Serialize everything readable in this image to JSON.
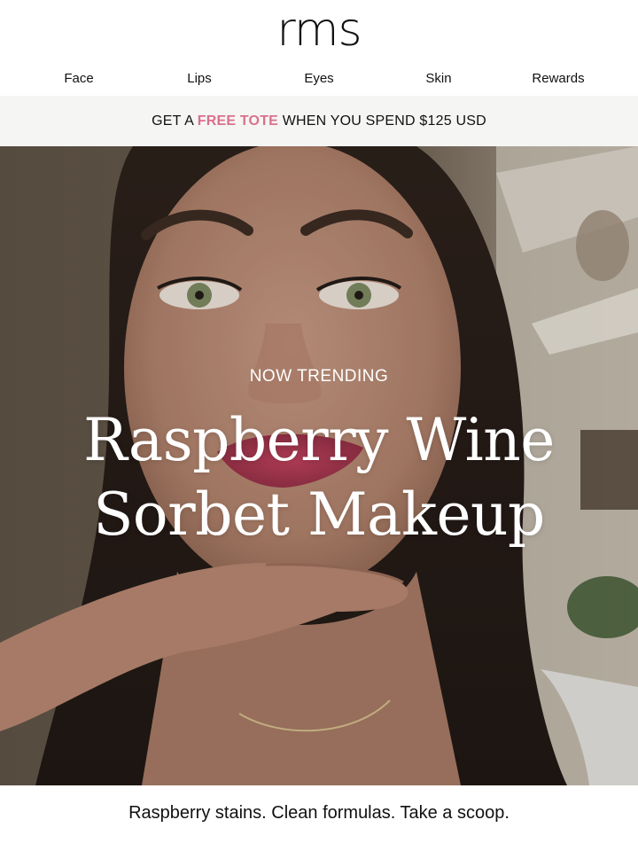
{
  "brand": {
    "logo": "rms"
  },
  "nav": {
    "items": [
      "Face",
      "Lips",
      "Eyes",
      "Skin",
      "Rewards"
    ]
  },
  "promo": {
    "prefix": "GET A ",
    "highlight": "FREE TOTE",
    "suffix": " WHEN YOU SPEND $125 USD",
    "highlight_color": "#d9718b",
    "background": "#f5f5f4"
  },
  "hero": {
    "eyebrow": "NOW TRENDING",
    "title_line1": "Raspberry Wine",
    "title_line2": "Sorbet Makeup",
    "image_subject": "woman-smiling-raspberry-lip-photo"
  },
  "tagline": "Raspberry stains. Clean formulas. Take a scoop."
}
